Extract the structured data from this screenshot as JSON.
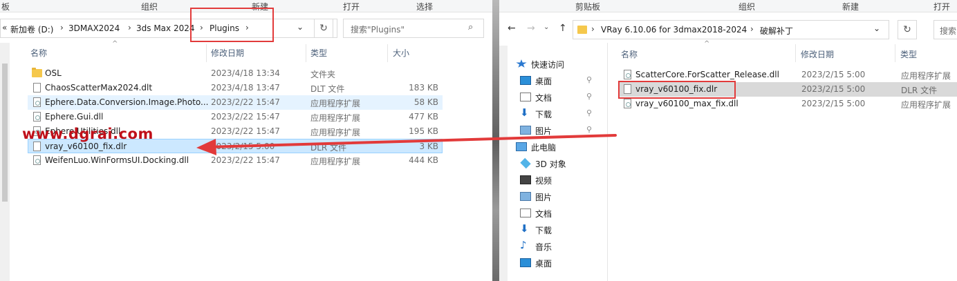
{
  "left": {
    "ribbon": [
      "板",
      "组织",
      "新建",
      "打开",
      "选择"
    ],
    "breadcrumb": [
      "新加卷 (D:)",
      "3DMAX2024",
      "3ds Max 2024",
      "Plugins"
    ],
    "search_placeholder": "搜索\"Plugins\"",
    "columns": {
      "name": "名称",
      "date": "修改日期",
      "type": "类型",
      "size": "大小"
    },
    "files": [
      {
        "name": "OSL",
        "date": "2023/4/18 13:34",
        "type": "文件夹",
        "size": "",
        "icon": "folder-icon"
      },
      {
        "name": "ChaosScatterMax2024.dlt",
        "date": "2023/4/18 13:47",
        "type": "DLT 文件",
        "size": "183 KB",
        "icon": "file-icon"
      },
      {
        "name": "Ephere.Data.Conversion.Image.Photo...",
        "date": "2023/2/22 15:47",
        "type": "应用程序扩展",
        "size": "58 KB",
        "icon": "dll-icon"
      },
      {
        "name": "Ephere.Gui.dll",
        "date": "2023/2/22 15:47",
        "type": "应用程序扩展",
        "size": "477 KB",
        "icon": "dll-icon"
      },
      {
        "name": "Ephere.Utilities.dll",
        "date": "2023/2/22 15:47",
        "type": "应用程序扩展",
        "size": "195 KB",
        "icon": "dll-icon"
      },
      {
        "name": "vray_v60100_fix.dlr",
        "date": "2023/2/15 5:00",
        "type": "DLR 文件",
        "size": "3 KB",
        "icon": "file-icon"
      },
      {
        "name": "WeifenLuo.WinFormsUI.Docking.dll",
        "date": "2023/2/22 15:47",
        "type": "应用程序扩展",
        "size": "444 KB",
        "icon": "dll-icon"
      }
    ]
  },
  "right": {
    "ribbon": [
      "剪贴板",
      "组织",
      "新建",
      "打开"
    ],
    "breadcrumb": [
      "VRay 6.10.06 for 3dmax2018-2024",
      "破解补丁"
    ],
    "search_placeholder": "搜索",
    "nav": [
      {
        "label": "快速访问",
        "icon": "star-icon",
        "pinned": false,
        "indent": 0
      },
      {
        "label": "桌面",
        "icon": "desktop-icon",
        "pinned": true,
        "indent": 1
      },
      {
        "label": "文档",
        "icon": "documents-icon",
        "pinned": true,
        "indent": 1
      },
      {
        "label": "下载",
        "icon": "download-icon",
        "pinned": true,
        "indent": 1
      },
      {
        "label": "图片",
        "icon": "pictures-icon",
        "pinned": true,
        "indent": 1
      },
      {
        "label": "此电脑",
        "icon": "computer-icon",
        "pinned": false,
        "indent": 0
      },
      {
        "label": "3D 对象",
        "icon": "3d-objects-icon",
        "pinned": false,
        "indent": 1
      },
      {
        "label": "视频",
        "icon": "video-icon",
        "pinned": false,
        "indent": 1
      },
      {
        "label": "图片",
        "icon": "pictures-icon",
        "pinned": false,
        "indent": 1
      },
      {
        "label": "文档",
        "icon": "documents-icon",
        "pinned": false,
        "indent": 1
      },
      {
        "label": "下载",
        "icon": "download-icon",
        "pinned": false,
        "indent": 1
      },
      {
        "label": "音乐",
        "icon": "music-icon",
        "pinned": false,
        "indent": 1
      },
      {
        "label": "桌面",
        "icon": "desktop-icon",
        "pinned": false,
        "indent": 1
      }
    ],
    "columns": {
      "name": "名称",
      "date": "修改日期",
      "type": "类型"
    },
    "files": [
      {
        "name": "ScatterCore.ForScatter_Release.dll",
        "date": "2023/2/15 5:00",
        "type": "应用程序扩展",
        "icon": "dll-icon"
      },
      {
        "name": "vray_v60100_fix.dlr",
        "date": "2023/2/15 5:00",
        "type": "DLR 文件",
        "icon": "file-icon"
      },
      {
        "name": "vray_v60100_max_fix.dll",
        "date": "2023/2/15 5:00",
        "type": "应用程序扩展",
        "icon": "dll-icon"
      }
    ]
  },
  "watermark": "www.dgrai.com",
  "colors": {
    "highlight_box": "#e23a3a",
    "selected_row": "#cce8ff",
    "hover_row": "#e5f3ff",
    "watermark": "#c0101a"
  }
}
